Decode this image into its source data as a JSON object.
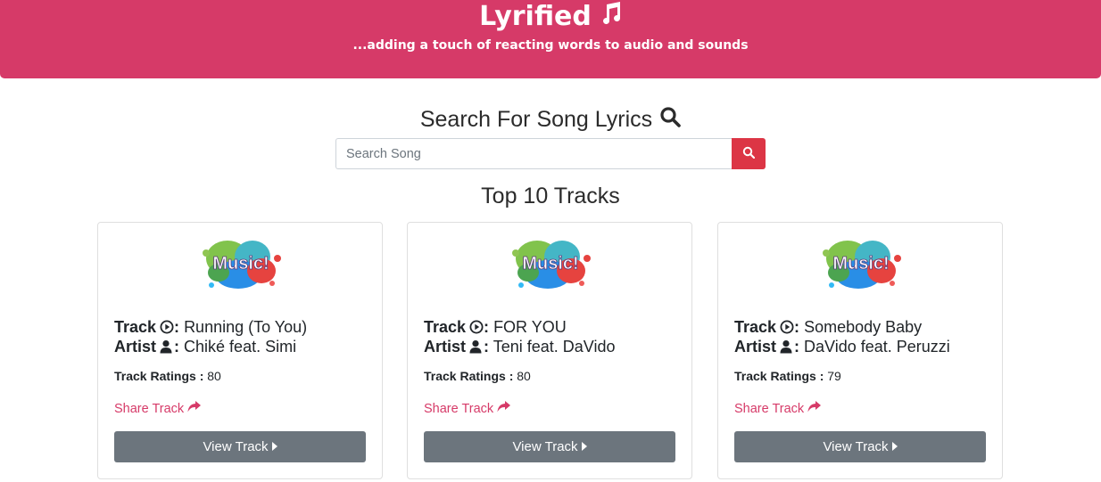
{
  "header": {
    "title": "Lyrified",
    "tagline": "...adding a touch of reacting words to audio and sounds",
    "background": "#d63a68"
  },
  "search": {
    "heading": "Search For Song Lyrics",
    "placeholder": "Search Song",
    "button_color": "#dc3545"
  },
  "top_tracks": {
    "heading": "Top 10 Tracks",
    "track_label": "Track",
    "artist_label": "Artist",
    "ratings_label": "Track Ratings :",
    "share_label": "Share Track",
    "view_label": "View Track",
    "items": [
      {
        "track": "Running (To You)",
        "artist": "Chiké feat. Simi",
        "rating": "80"
      },
      {
        "track": "FOR YOU",
        "artist": "Teni feat. DaVido",
        "rating": "80"
      },
      {
        "track": "Somebody Baby",
        "artist": "DaVido feat. Peruzzi",
        "rating": "79"
      }
    ]
  },
  "icons": [
    "music-note-icon",
    "search-icon",
    "play-circle-icon",
    "user-icon",
    "share-icon",
    "caret-right-icon"
  ],
  "colors": {
    "accent": "#d63a68",
    "button_gray": "#6c757d"
  }
}
